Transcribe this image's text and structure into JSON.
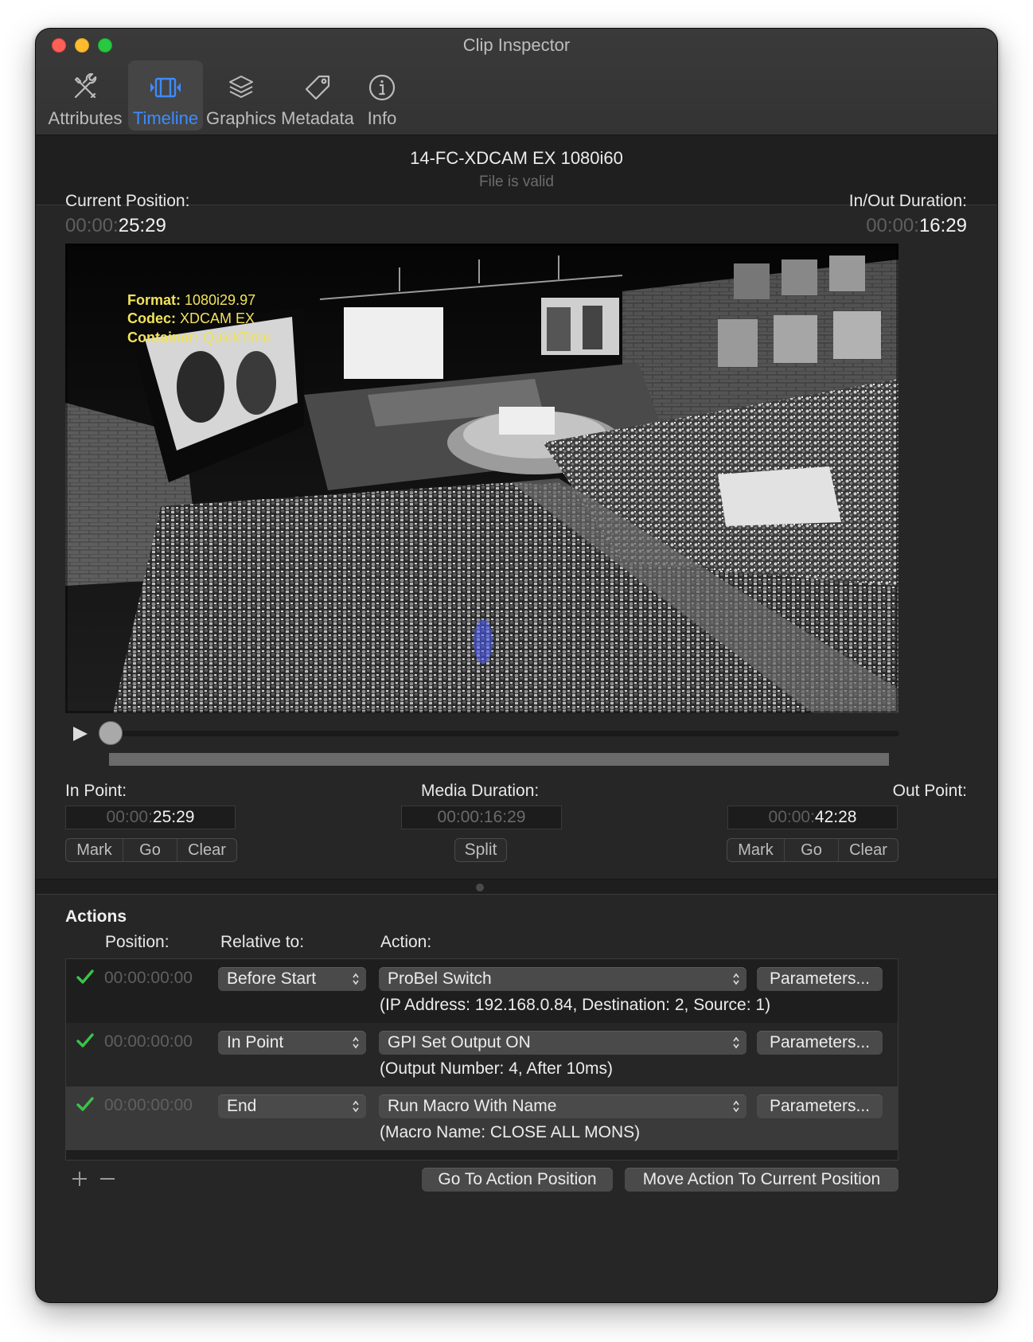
{
  "window": {
    "title": "Clip Inspector"
  },
  "toolbar": {
    "items": [
      {
        "label": "Attributes",
        "icon": "tools-icon"
      },
      {
        "label": "Timeline",
        "icon": "film-strip-icon",
        "active": true
      },
      {
        "label": "Graphics",
        "icon": "layers-icon"
      },
      {
        "label": "Metadata",
        "icon": "tag-icon"
      },
      {
        "label": "Info",
        "icon": "info-icon"
      }
    ],
    "active_color": "#3d8bff"
  },
  "clip": {
    "name": "14-FC-XDCAM EX 1080i60",
    "status": "File is valid"
  },
  "position": {
    "current_label": "Current Position:",
    "current_dim": "00:00:",
    "current_value": "25:29",
    "inout_label": "In/Out Duration:",
    "inout_dim": "00:00:",
    "inout_value": "16:29"
  },
  "video": {
    "overlay": {
      "format_label": "Format:",
      "format_value": "1080i29.97",
      "codec_label": "Codec:",
      "codec_value": "XDCAM EX",
      "container_label": "Container:",
      "container_value": "QuickTime"
    }
  },
  "points": {
    "in_label": "In Point:",
    "in_dim": "00:00:",
    "in_value": "25:29",
    "media_label": "Media Duration:",
    "media_value": "00:00:16:29",
    "out_label": "Out Point:",
    "out_dim": "00:00:",
    "out_value": "42:28",
    "mark": "Mark",
    "go": "Go",
    "clear": "Clear",
    "split": "Split"
  },
  "actions": {
    "title": "Actions",
    "col_position": "Position:",
    "col_relative": "Relative to:",
    "col_action": "Action:",
    "rows": [
      {
        "enabled": true,
        "position": "00:00:00:00",
        "relative": "Before Start",
        "action": "ProBel Switch",
        "parameters_label": "Parameters...",
        "detail": "(IP Address: 192.168.0.84, Destination: 2, Source: 1)"
      },
      {
        "enabled": true,
        "position": "00:00:00:00",
        "relative": "In Point",
        "action": "GPI Set Output ON",
        "parameters_label": "Parameters...",
        "detail": "(Output Number: 4, After 10ms)"
      },
      {
        "enabled": true,
        "selected": true,
        "position": "00:00:00:00",
        "relative": "End",
        "action": "Run Macro With Name",
        "parameters_label": "Parameters...",
        "detail": "(Macro Name: CLOSE ALL MONS)"
      }
    ],
    "go_to_label": "Go To Action Position",
    "move_label": "Move Action To Current Position",
    "check_color": "#3cc24a"
  }
}
